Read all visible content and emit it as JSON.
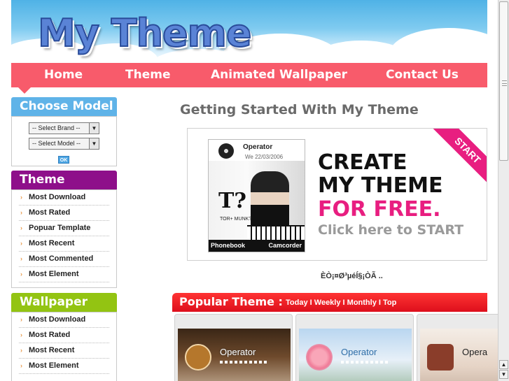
{
  "header": {
    "logo_text": "My Theme"
  },
  "nav": {
    "items": [
      "Home",
      "Theme",
      "Animated Wallpaper",
      "Contact Us"
    ]
  },
  "sidebar": {
    "choose_model": {
      "title": "Choose Model",
      "brand_select": "-- Select Brand --",
      "model_select": "-- Select Model --",
      "ok_label": "OK"
    },
    "theme": {
      "title": "Theme",
      "items": [
        "Most Download",
        "Most Rated",
        "Popuar Template",
        "Most Recent",
        "Most Commented",
        "Most Element"
      ]
    },
    "wallpaper": {
      "title": "Wallpaper",
      "items": [
        "Most Download",
        "Most Rated",
        "Most Recent",
        "Most Element"
      ]
    }
  },
  "main": {
    "title": "Getting Started With My Theme",
    "banner": {
      "phone_operator": "Operator",
      "phone_date": "We 22/03/2006",
      "phone_logo": "T?",
      "phone_logo_sub": "TOR+ MUNK?",
      "phone_left_soft": "Phonebook",
      "phone_right_soft": "Camcorder",
      "line1": "CREATE",
      "line2": "MY THEME",
      "line3": "FOR FREE.",
      "line4": "Click here to START",
      "ribbon": "START"
    },
    "thai_text": "ÈÒ¡¤Ø³µéÍ§¡ÒÃ ..",
    "popular": {
      "title": "Popular Theme :",
      "links": [
        "Today",
        "I",
        "Weekly",
        "I",
        "Monthly",
        "I",
        "Top"
      ],
      "cards": [
        {
          "operator": "Operator"
        },
        {
          "operator": "Operator"
        },
        {
          "operator": "Opera"
        }
      ]
    }
  },
  "colors": {
    "nav_bg": "#f85b6b",
    "choose_model_bg": "#5fb3e8",
    "theme_bg": "#8e0f8a",
    "wallpaper_bg": "#93c412",
    "popular_bg": "#dd0f1c",
    "banner_pink": "#e81e80"
  }
}
